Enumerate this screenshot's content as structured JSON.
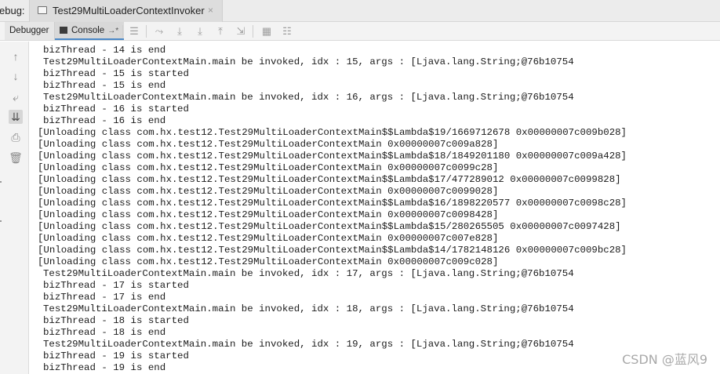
{
  "header": {
    "debug_label": "ebug:",
    "run_tab_title": "Test29MultiLoaderContextInvoker",
    "close_glyph": "×"
  },
  "toolbar": {
    "debugger_label": "Debugger",
    "console_label": "Console",
    "pin_glyph": "→*"
  },
  "console": {
    "lines": [
      {
        "text": "bizThread - 14 is end",
        "kind": "out"
      },
      {
        "text": "Test29MultiLoaderContextMain.main be invoked, idx : 15, args : [Ljava.lang.String;@76b10754",
        "kind": "out"
      },
      {
        "text": "bizThread - 15 is started",
        "kind": "out"
      },
      {
        "text": "bizThread - 15 is end",
        "kind": "out"
      },
      {
        "text": "Test29MultiLoaderContextMain.main be invoked, idx : 16, args : [Ljava.lang.String;@76b10754",
        "kind": "out"
      },
      {
        "text": "bizThread - 16 is started",
        "kind": "out"
      },
      {
        "text": "bizThread - 16 is end",
        "kind": "out"
      },
      {
        "text": "[Unloading class com.hx.test12.Test29MultiLoaderContextMain$$Lambda$19/1669712678 0x00000007c009b028]",
        "kind": "gc"
      },
      {
        "text": "[Unloading class com.hx.test12.Test29MultiLoaderContextMain 0x00000007c009a828]",
        "kind": "gc"
      },
      {
        "text": "[Unloading class com.hx.test12.Test29MultiLoaderContextMain$$Lambda$18/1849201180 0x00000007c009a428]",
        "kind": "gc"
      },
      {
        "text": "[Unloading class com.hx.test12.Test29MultiLoaderContextMain 0x00000007c0099c28]",
        "kind": "gc"
      },
      {
        "text": "[Unloading class com.hx.test12.Test29MultiLoaderContextMain$$Lambda$17/477289012 0x00000007c0099828]",
        "kind": "gc"
      },
      {
        "text": "[Unloading class com.hx.test12.Test29MultiLoaderContextMain 0x00000007c0099028]",
        "kind": "gc"
      },
      {
        "text": "[Unloading class com.hx.test12.Test29MultiLoaderContextMain$$Lambda$16/1898220577 0x00000007c0098c28]",
        "kind": "gc"
      },
      {
        "text": "[Unloading class com.hx.test12.Test29MultiLoaderContextMain 0x00000007c0098428]",
        "kind": "gc"
      },
      {
        "text": "[Unloading class com.hx.test12.Test29MultiLoaderContextMain$$Lambda$15/280265505 0x00000007c0097428]",
        "kind": "gc"
      },
      {
        "text": "[Unloading class com.hx.test12.Test29MultiLoaderContextMain 0x00000007c007e828]",
        "kind": "gc"
      },
      {
        "text": "[Unloading class com.hx.test12.Test29MultiLoaderContextMain$$Lambda$14/1782148126 0x00000007c009bc28]",
        "kind": "gc"
      },
      {
        "text": "[Unloading class com.hx.test12.Test29MultiLoaderContextMain 0x00000007c009c028]",
        "kind": "gc"
      },
      {
        "text": "Test29MultiLoaderContextMain.main be invoked, idx : 17, args : [Ljava.lang.String;@76b10754",
        "kind": "out"
      },
      {
        "text": "bizThread - 17 is started",
        "kind": "out"
      },
      {
        "text": "bizThread - 17 is end",
        "kind": "out"
      },
      {
        "text": "Test29MultiLoaderContextMain.main be invoked, idx : 18, args : [Ljava.lang.String;@76b10754",
        "kind": "out"
      },
      {
        "text": "bizThread - 18 is started",
        "kind": "out"
      },
      {
        "text": "bizThread - 18 is end",
        "kind": "out"
      },
      {
        "text": "Test29MultiLoaderContextMain.main be invoked, idx : 19, args : [Ljava.lang.String;@76b10754",
        "kind": "out"
      },
      {
        "text": "bizThread - 19 is started",
        "kind": "out"
      },
      {
        "text": "bizThread - 19 is end",
        "kind": "out"
      }
    ]
  },
  "watermark": "CSDN @蓝风9",
  "icons": {
    "toolbar": [
      "soft-wrap-icon",
      "show-execution-point-icon",
      "step-over-icon",
      "step-into-icon",
      "step-out-icon",
      "run-to-cursor-icon",
      "evaluate-icon",
      "layout-icon"
    ],
    "gutter": [
      "scroll-up-icon",
      "scroll-down-icon",
      "soft-wrap-icon",
      "scroll-to-end-icon",
      "print-icon",
      "clear-all-icon"
    ]
  },
  "colors": {
    "accent": "#4a88c7",
    "text": "#1b1b1b",
    "panel": "#f3f3f3"
  }
}
